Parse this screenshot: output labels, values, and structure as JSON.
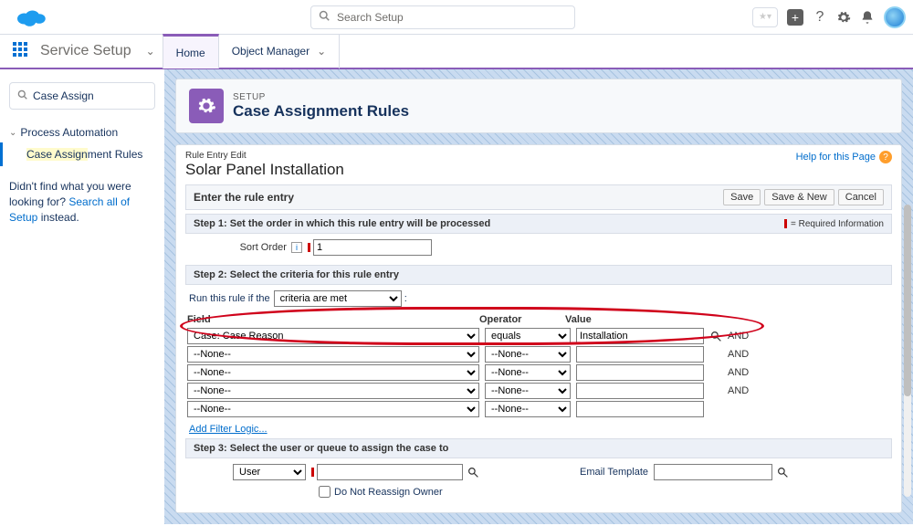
{
  "header": {
    "search_placeholder": "Search Setup"
  },
  "nav": {
    "app": "Service Setup",
    "tab_home": "Home",
    "tab_object_manager": "Object Manager"
  },
  "sidebar": {
    "search_value": "Case Assign",
    "group": "Process Automation",
    "item_active": "Case Assignment Rules",
    "item_active_hl": "Case Assign",
    "item_active_rest": "ment Rules",
    "nofind_pre": "Didn't find what you were looking for? ",
    "nofind_link": "Search all of Setup",
    "nofind_post": " instead."
  },
  "page": {
    "sup": "SETUP",
    "title": "Case Assignment Rules"
  },
  "rule": {
    "breadcrumb": "Rule Entry Edit",
    "name": "Solar Panel Installation",
    "help": "Help for this Page",
    "section_title": "Enter the rule entry",
    "btn_save": "Save",
    "btn_save_new": "Save & New",
    "btn_cancel": "Cancel",
    "step1": "Step 1: Set the order in which this rule entry will be processed",
    "req_info": "= Required Information",
    "sort_order_label": "Sort Order",
    "sort_order_value": "1",
    "step2": "Step 2: Select the criteria for this rule entry",
    "run_rule_label": "Run this rule if the",
    "run_rule_sel": "criteria are met",
    "col_field": "Field",
    "col_operator": "Operator",
    "col_value": "Value",
    "and": "AND",
    "rows": [
      {
        "field": "Case: Case Reason",
        "op": "equals",
        "val": "Installation"
      },
      {
        "field": "--None--",
        "op": "--None--",
        "val": ""
      },
      {
        "field": "--None--",
        "op": "--None--",
        "val": ""
      },
      {
        "field": "--None--",
        "op": "--None--",
        "val": ""
      },
      {
        "field": "--None--",
        "op": "--None--",
        "val": ""
      }
    ],
    "add_filter": "Add Filter Logic...",
    "step3": "Step 3: Select the user or queue to assign the case to",
    "assign_type": "User",
    "no_reassign": "Do Not Reassign Owner",
    "email_tpl": "Email Template"
  }
}
